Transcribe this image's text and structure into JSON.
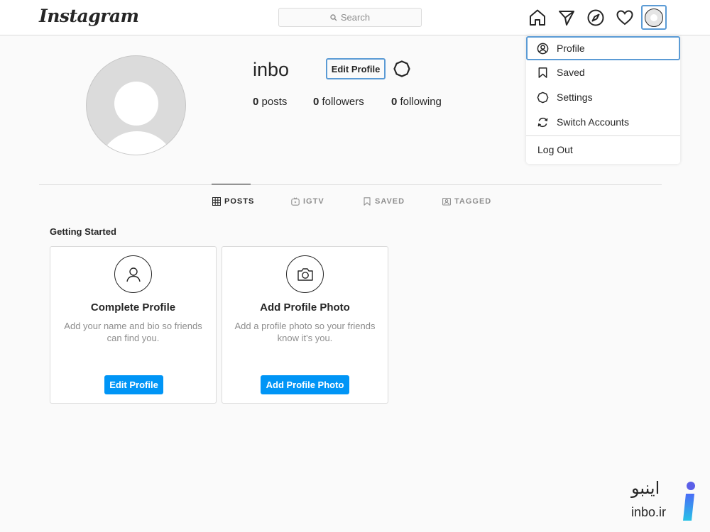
{
  "topbar": {
    "logo": "Instagram",
    "search_placeholder": "Search",
    "nav_icons": [
      "home-icon",
      "direct-icon",
      "explore-icon",
      "activity-icon",
      "profile-avatar-icon"
    ]
  },
  "dropdown": {
    "items": [
      {
        "label": "Profile",
        "icon": "profile-icon"
      },
      {
        "label": "Saved",
        "icon": "bookmark-icon"
      },
      {
        "label": "Settings",
        "icon": "settings-icon"
      },
      {
        "label": "Switch Accounts",
        "icon": "switch-icon"
      }
    ],
    "logout": "Log Out"
  },
  "profile": {
    "username": "inbo",
    "edit_button": "Edit Profile",
    "stats": [
      {
        "count": "0",
        "label": "posts"
      },
      {
        "count": "0",
        "label": "followers"
      },
      {
        "count": "0",
        "label": "following"
      }
    ]
  },
  "tabs": [
    {
      "label": "POSTS",
      "icon": "grid-icon",
      "active": true
    },
    {
      "label": "IGTV",
      "icon": "igtv-icon",
      "active": false
    },
    {
      "label": "SAVED",
      "icon": "bookmark-icon",
      "active": false
    },
    {
      "label": "TAGGED",
      "icon": "tagged-icon",
      "active": false
    }
  ],
  "getting_started": {
    "title": "Getting Started",
    "cards": [
      {
        "title": "Complete Profile",
        "description": "Add your name and bio so friends can find you.",
        "button": "Edit Profile",
        "icon": "person-icon"
      },
      {
        "title": "Add Profile Photo",
        "description": "Add a profile photo so your friends know it's you.",
        "button": "Add Profile Photo",
        "icon": "camera-icon"
      }
    ]
  },
  "watermark": {
    "text_fa": "اینبو",
    "text_en": "inbo.ir"
  },
  "colors": {
    "accent_blue": "#0095f6",
    "focus_outline": "#5b9bd5",
    "border": "#dbdbdb",
    "background": "#fafafa"
  }
}
